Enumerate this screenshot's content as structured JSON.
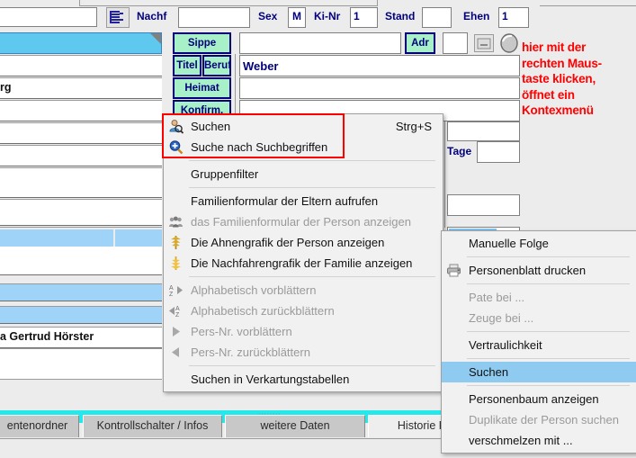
{
  "window": {
    "background": "#ececec",
    "accent_blue": "#00007a",
    "green_button": "#a8f0c8",
    "selection_blue": "#8fcbf0",
    "cyan_bar": "#25e8ea",
    "annotation_red": "#ff0000"
  },
  "form": {
    "labels": {
      "nachf": "Nachf",
      "sex": "Sex",
      "kinr": "Ki-Nr",
      "stand": "Stand",
      "ehen": "Ehen",
      "tage": "Tage"
    },
    "values": {
      "name_left": "",
      "nachf": "",
      "sex": "M",
      "kinr": "1",
      "stand": "",
      "ehen": "1",
      "beruf": "Weber",
      "sippe": "",
      "heimat": "",
      "konfirm": "",
      "adr_code": "",
      "ort_partial": "rg",
      "person_name": "a Gertrud Hörster",
      "tage": ""
    },
    "green_buttons": {
      "sippe": "Sippe",
      "titel": "Titel",
      "beruf": "Beruf",
      "heimat": "Heimat",
      "konfirm": "Konfirm.",
      "adr": "Adr"
    }
  },
  "annotation": {
    "lines": [
      "hier mit der",
      "rechten Maus-",
      "taste klicken,",
      "öffnet ein",
      "Kontexmenü"
    ]
  },
  "context_menu": {
    "items": [
      {
        "label": "Suchen",
        "accel": "Strg+S",
        "icon": "person-search-icon",
        "disabled": false,
        "separator_after": false
      },
      {
        "label": "Suche nach Suchbegriffen",
        "accel": "",
        "icon": "magnifier-plus-icon",
        "disabled": false,
        "separator_after": true
      },
      {
        "label": "Gruppenfilter",
        "accel": "",
        "icon": "",
        "disabled": false,
        "separator_after": true
      },
      {
        "label": "Familienformular der Eltern aufrufen",
        "accel": "",
        "icon": "",
        "disabled": false,
        "separator_after": false
      },
      {
        "label": "das Familienformular der Person anzeigen",
        "accel": "",
        "icon": "family-group-icon",
        "disabled": true,
        "separator_after": false
      },
      {
        "label": "Die Ahnengrafik der Person anzeigen",
        "accel": "",
        "icon": "ancestor-tree-icon",
        "disabled": false,
        "separator_after": false
      },
      {
        "label": "Die Nachfahrengrafik der Familie anzeigen",
        "accel": "",
        "icon": "descendant-tree-icon",
        "disabled": false,
        "separator_after": true
      },
      {
        "label": "Alphabetisch vorblättern",
        "accel": "",
        "icon": "az-forward-icon",
        "disabled": true,
        "separator_after": false
      },
      {
        "label": "Alphabetisch zurückblättern",
        "accel": "",
        "icon": "az-backward-icon",
        "disabled": true,
        "separator_after": false
      },
      {
        "label": "Pers-Nr. vorblättern",
        "accel": "",
        "icon": "triangle-right-icon",
        "disabled": true,
        "separator_after": false
      },
      {
        "label": "Pers-Nr. zurückblättern",
        "accel": "",
        "icon": "triangle-left-icon",
        "disabled": true,
        "separator_after": true
      },
      {
        "label": "Suchen in Verkartungstabellen",
        "accel": "",
        "icon": "",
        "disabled": false,
        "separator_after": false
      }
    ]
  },
  "sub_menu": {
    "items": [
      {
        "label": "Manuelle Folge",
        "icon": "",
        "disabled": false,
        "selected": false,
        "separator_after": true
      },
      {
        "label": "Personenblatt drucken",
        "icon": "printer-icon",
        "disabled": false,
        "selected": false,
        "separator_after": true
      },
      {
        "label": "Pate bei ...",
        "icon": "",
        "disabled": true,
        "selected": false,
        "separator_after": false
      },
      {
        "label": "Zeuge bei ...",
        "icon": "",
        "disabled": true,
        "selected": false,
        "separator_after": true
      },
      {
        "label": "Vertraulichkeit",
        "icon": "",
        "disabled": false,
        "selected": false,
        "separator_after": true
      },
      {
        "label": "Suchen",
        "icon": "",
        "disabled": false,
        "selected": true,
        "separator_after": true
      },
      {
        "label": "Personenbaum anzeigen",
        "icon": "",
        "disabled": false,
        "selected": false,
        "separator_after": false
      },
      {
        "label": "Duplikate der Person suchen",
        "icon": "",
        "disabled": true,
        "selected": false,
        "separator_after": false
      },
      {
        "label": "verschmelzen mit ...",
        "icon": "",
        "disabled": false,
        "selected": false,
        "separator_after": false
      }
    ]
  },
  "tabs": [
    {
      "label": "entenordner",
      "active": false
    },
    {
      "label": "Kontrollschalter / Infos",
      "active": false
    },
    {
      "label": "weitere Daten",
      "active": false
    },
    {
      "label": "Historie P",
      "active": true
    }
  ]
}
